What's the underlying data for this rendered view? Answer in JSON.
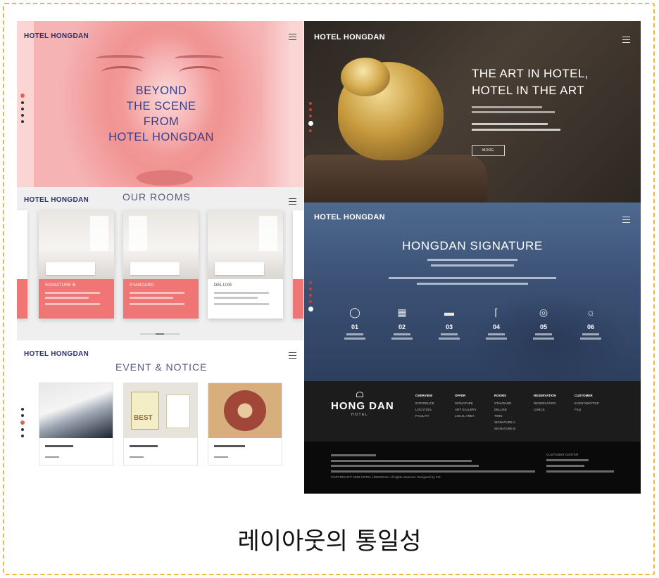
{
  "caption": "레이아웃의 통일성",
  "brand": "HOTEL HONGDAN",
  "left": {
    "hero": {
      "title": "BEYOND\nTHE SCENE\nFROM\nHOTEL HONGDAN"
    },
    "rooms": {
      "title": "OUR ROOMS",
      "cards": [
        {
          "name": "SIGNATURE B"
        },
        {
          "name": "STANDARD"
        },
        {
          "name": "DELUXE"
        }
      ]
    },
    "event": {
      "title": "EVENT & NOTICE",
      "cards": [
        {
          "image": "air-conditioner-photo"
        },
        {
          "image": "best-award-photo",
          "image_text": "BEST"
        },
        {
          "image": "seal-photo"
        }
      ]
    }
  },
  "right": {
    "hero": {
      "title": "THE ART IN HOTEL,\nHOTEL IN THE ART",
      "button": "MORE"
    },
    "signature": {
      "title": "HONGDAN SIGNATURE",
      "items": [
        {
          "num": "01",
          "icon": "sanitizer-icon"
        },
        {
          "num": "02",
          "icon": "bed-frame-icon"
        },
        {
          "num": "03",
          "icon": "bed-icon"
        },
        {
          "num": "04",
          "icon": "faucet-icon"
        },
        {
          "num": "05",
          "icon": "globe-icon"
        },
        {
          "num": "06",
          "icon": "lamp-icon"
        }
      ]
    },
    "footer": {
      "logo": "HONG DAN",
      "logo_sub": "HOTEL",
      "columns": [
        {
          "title": "OVERVIEW",
          "items": [
            "INTRODUCE",
            "LOCATION",
            "FACILITY"
          ]
        },
        {
          "title": "OFFER",
          "items": [
            "SIGNATURE",
            "ART GALLERY",
            "LOCAL AREA"
          ]
        },
        {
          "title": "ROOMS",
          "items": [
            "STANDARD",
            "DELUXE",
            "TWIN",
            "SIGNATURE A",
            "SIGNATURE B"
          ]
        },
        {
          "title": "RESERVATION",
          "items": [
            "RESERVATION",
            "CHECK"
          ]
        },
        {
          "title": "CUSTOMER",
          "items": [
            "EVENT&NOTICE",
            "FAQ"
          ]
        }
      ],
      "customer_center": "CUSTOMER CENTER",
      "copyright": "COPYRIGHT© 2020 HOTEL HONGDAN. All rights reserved. Designed by FIX"
    }
  },
  "colors": {
    "accent_coral": "#f07676",
    "navy_text": "#2c3170",
    "frame": "#f3b53a"
  }
}
